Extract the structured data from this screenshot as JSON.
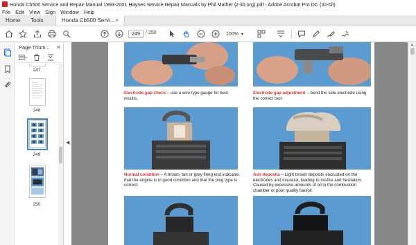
{
  "window": {
    "title": "Honda Cb500 Service and Repair Manual 1993-2001 Haynes Service  Repair Manuals by Phil Mather (z-lib.org).pdf - Adobe Acrobat Pro DC (32-bit)"
  },
  "menu": [
    "File",
    "Edit",
    "View",
    "Sign",
    "Window",
    "Help"
  ],
  "tabs": {
    "home": "Home",
    "tools": "Tools",
    "document": "Honda Cb500 Servi...",
    "close": "×"
  },
  "toolbar": {
    "current_page": "249",
    "total_pages": "/ 250",
    "zoom": "100%"
  },
  "thumbnails_panel": {
    "title": "Page Thum...",
    "close": "×",
    "items": [
      {
        "label": "247"
      },
      {
        "label": "248"
      },
      {
        "label": "249"
      },
      {
        "label": "250"
      }
    ]
  },
  "page": {
    "captions": [
      {
        "highlight": "Electrode gap check",
        "text": " – use a wire type gauge for best results."
      },
      {
        "highlight": "Electrode gap adjustment",
        "text": " – bend the side electrode using the correct tool."
      },
      {
        "highlight": "Normal condition",
        "text": " – A brown, tan or grey firing end indicates that the engine is in good condition and that the plug type is correct."
      },
      {
        "highlight": "Ash deposits",
        "text": " – Light brown deposits encrusted on the electrodes and insulator, leading to misfire and hesitation. Caused by excessive amounts of oil in the combustion chamber or poor quality fuel/oil."
      }
    ]
  },
  "colors": {
    "accent": "#3b82d6",
    "caption_highlight": "#d6312a",
    "photo_blue": "#5b9bd0",
    "doc_background": "#878787"
  }
}
